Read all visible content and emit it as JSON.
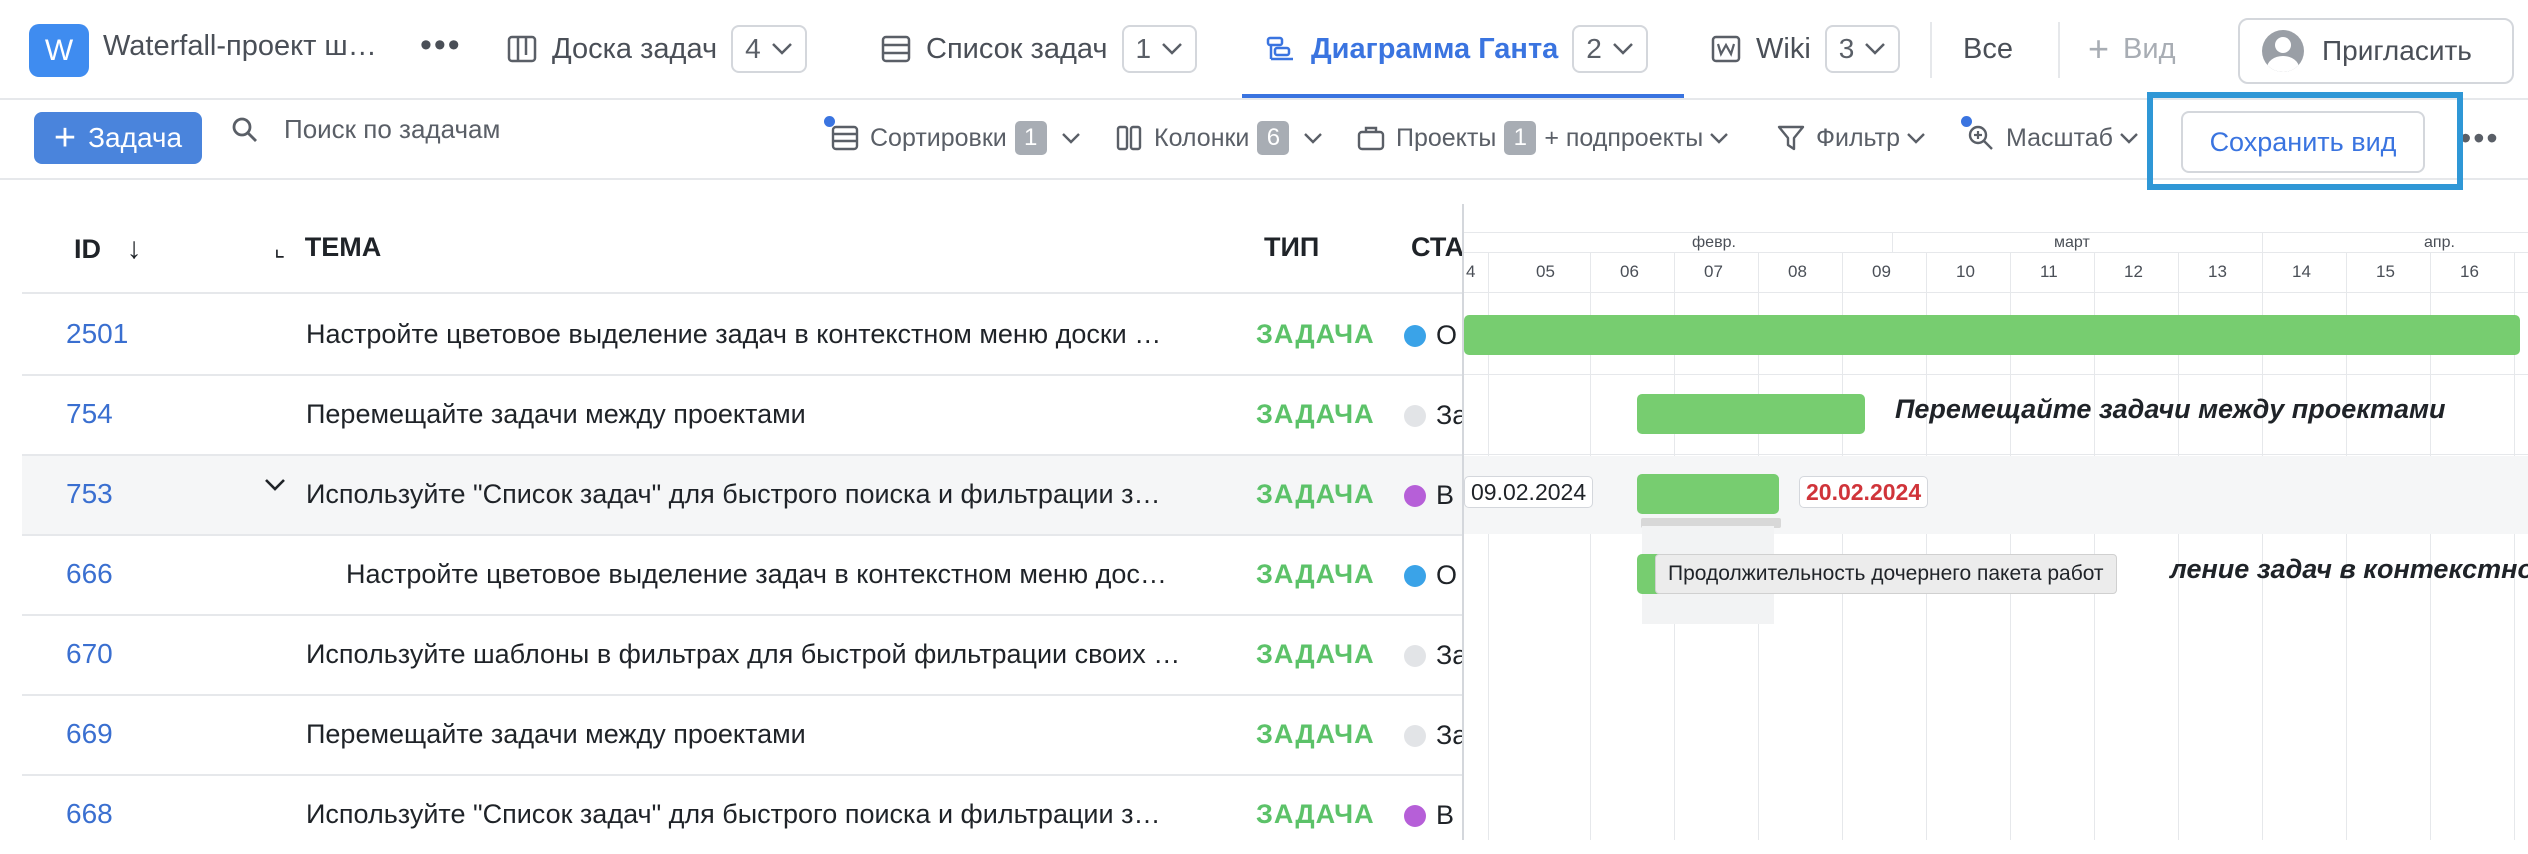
{
  "project": {
    "logo_letter": "W",
    "title": "Waterfall-проект ш…"
  },
  "tabs": [
    {
      "label": "Доска задач",
      "count": "4"
    },
    {
      "label": "Список задач",
      "count": "1"
    },
    {
      "label": "Диаграмма Ганта",
      "count": "2"
    },
    {
      "label": "Wiki",
      "count": "3"
    }
  ],
  "header": {
    "all_label": "Все",
    "add_view_label": "Вид",
    "invite_label": "Пригласить"
  },
  "toolbar": {
    "add_task_label": "Задача",
    "search_placeholder": "Поиск по задачам",
    "sort_label": "Сортировки",
    "sort_count": "1",
    "columns_label": "Колонки",
    "columns_count": "6",
    "projects_label": "Проекты",
    "projects_count": "1",
    "subprojects_label": "+ подпроекты",
    "filter_label": "Фильтр",
    "zoom_label": "Масштаб",
    "save_view_label": "Сохранить вид"
  },
  "table": {
    "columns": {
      "id": "ID",
      "theme": "ТЕМА",
      "type": "ТИП",
      "status": "СТА"
    },
    "rows": [
      {
        "id": "2501",
        "theme": "Настройте цветовое выделение задач в контекстном меню доски …",
        "type": "ЗАДАЧА",
        "status": "О",
        "status_color": "#3aa3e8"
      },
      {
        "id": "754",
        "theme": "Перемещайте задачи между проектами",
        "type": "ЗАДАЧА",
        "status": "За",
        "status_color": "#e2e4e7"
      },
      {
        "id": "753",
        "theme": "Используйте \"Список задач\" для быстрого поиска и фильтрации з…",
        "type": "ЗАДАЧА",
        "status": "В",
        "status_color": "#b65fd8"
      },
      {
        "id": "666",
        "theme": "Настройте цветовое выделение задач в контекстном меню дос…",
        "type": "ЗАДАЧА",
        "status": "О",
        "status_color": "#3aa3e8"
      },
      {
        "id": "670",
        "theme": "Используйте шаблоны в фильтрах для быстрой фильтрации своих …",
        "type": "ЗАДАЧА",
        "status": "За",
        "status_color": "#e2e4e7"
      },
      {
        "id": "669",
        "theme": "Перемещайте задачи между проектами",
        "type": "ЗАДАЧА",
        "status": "За",
        "status_color": "#e2e4e7"
      },
      {
        "id": "668",
        "theme": "Используйте \"Список задач\" для быстрого поиска и фильтрации з…",
        "type": "ЗАДАЧА",
        "status": "В",
        "status_color": "#b65fd8"
      }
    ]
  },
  "gantt": {
    "months": [
      "февр.",
      "март",
      "апр."
    ],
    "weeks": [
      "4",
      "05",
      "06",
      "07",
      "08",
      "09",
      "10",
      "11",
      "12",
      "13",
      "14",
      "15",
      "16"
    ],
    "bar_labels": {
      "row754": "Перемещайте задачи между проектами",
      "row666": "ление задач в контекстно"
    },
    "start_date": "09.02.2024",
    "end_date": "20.02.2024",
    "tooltip": "Продолжительность дочернего пакета работ",
    "bar_color": "#77cd70",
    "end_date_color": "#d0343a"
  }
}
